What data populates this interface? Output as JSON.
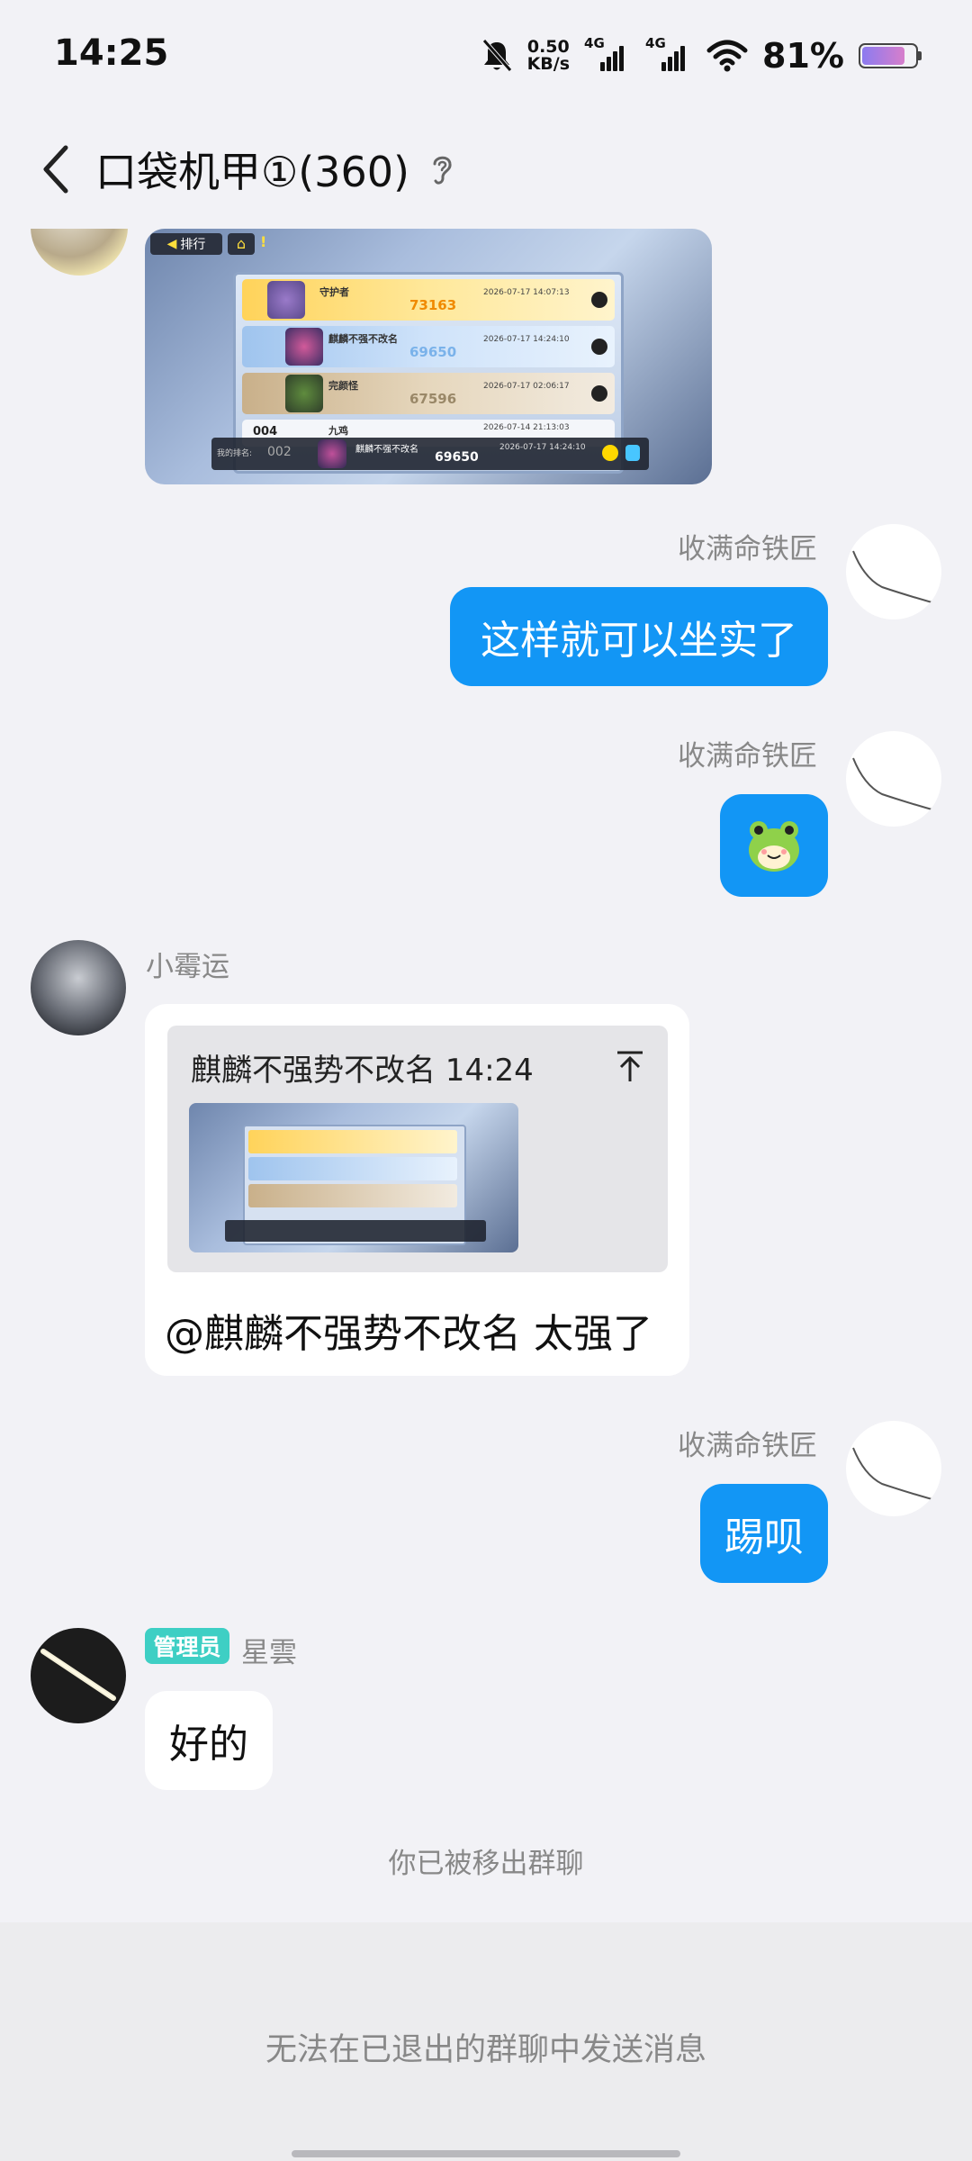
{
  "status_bar": {
    "time": "14:25",
    "net_speed_value": "0.50",
    "net_speed_unit": "KB/s",
    "signal1_label": "4G",
    "signal2_label": "4G",
    "battery_percent": "81%",
    "battery_level": 0.81,
    "icons": [
      "mute-bell-icon",
      "wifi-icon",
      "battery-icon"
    ]
  },
  "header": {
    "title": "口袋机甲①(360)",
    "back_icon": "chevron-left-icon",
    "ear_icon": "ear-icon"
  },
  "messages": [
    {
      "type": "image",
      "side": "left",
      "game": {
        "back_label": "排行",
        "rows": [
          {
            "rank": "",
            "name": "守护者",
            "score": "73163",
            "date": "2026-07-17 14:07:13"
          },
          {
            "rank": "",
            "name": "麒麟不强不改名",
            "score": "69650",
            "date": "2026-07-17 14:24:10"
          },
          {
            "rank": "",
            "name": "完颜怪",
            "score": "67596",
            "date": "2026-07-17 02:06:17"
          },
          {
            "rank": "004",
            "name": "九鸡",
            "score": "",
            "date": "2026-07-14 21:13:03"
          }
        ],
        "my_rank_label": "我的排名:",
        "my_rank": "002",
        "my_name": "麒麟不强不改名",
        "my_score": "69650",
        "my_date": "2026-07-17 14:24:10"
      }
    },
    {
      "type": "text",
      "side": "right",
      "sender": "收满命铁匠",
      "text": "这样就可以坐实了"
    },
    {
      "type": "sticker",
      "side": "right",
      "sender": "收满命铁匠",
      "sticker": "frog-sticker-icon"
    },
    {
      "type": "quote",
      "side": "left",
      "sender": "小霉运",
      "quote_header": "麒麟不强势不改名 14:24",
      "quote_icon": "jump-to-top-icon",
      "text": "@麒麟不强势不改名 太强了"
    },
    {
      "type": "text",
      "side": "right",
      "sender": "收满命铁匠",
      "text": "踢呗"
    },
    {
      "type": "text",
      "side": "left",
      "sender": "星雲",
      "badge": "管理员",
      "text": "好的"
    }
  ],
  "system_notice": "你已被移出群聊",
  "bottom_notice": "无法在已退出的群聊中发送消息"
}
